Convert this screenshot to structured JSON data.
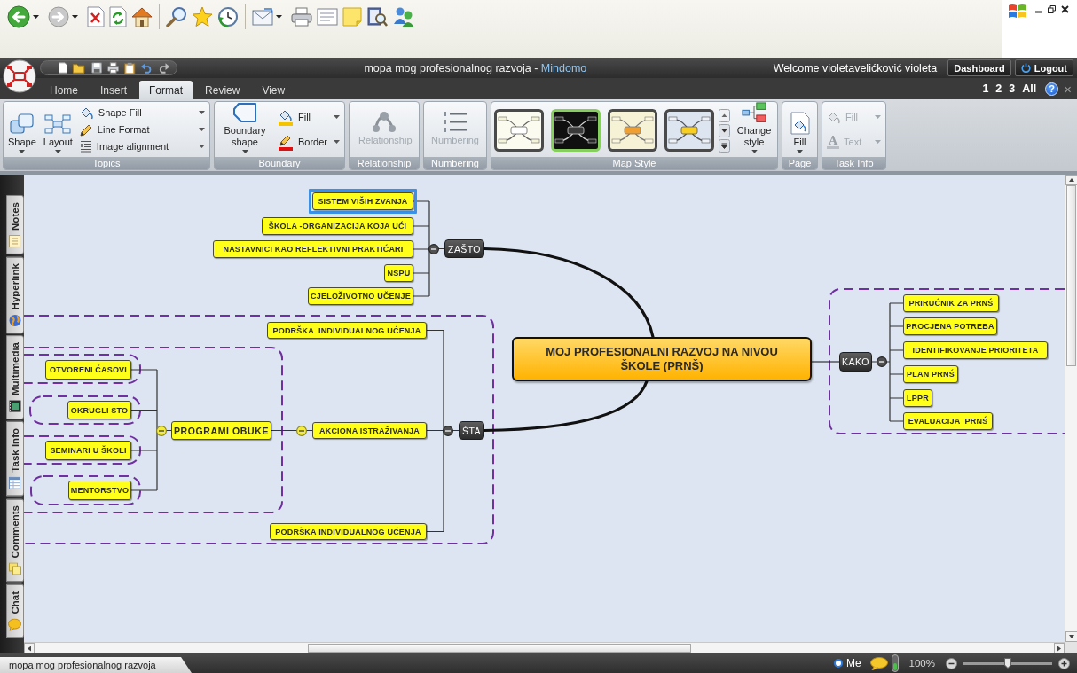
{
  "title_bar": {
    "document": "mopa mog profesionalnog razvoja",
    "separator": "-",
    "app_name": "Mindomo",
    "welcome": "Welcome violetavelićković violeta",
    "buttons": [
      "Dashboard",
      "Logout"
    ]
  },
  "tabs": [
    {
      "label": "Home",
      "selected": false
    },
    {
      "label": "Insert",
      "selected": false
    },
    {
      "label": "Format",
      "selected": true
    },
    {
      "label": "Review",
      "selected": false
    },
    {
      "label": "View",
      "selected": false
    }
  ],
  "view_levels": [
    "1",
    "2",
    "3",
    "All"
  ],
  "help": "?",
  "close": "×",
  "ribbon": [
    {
      "label": "Topics",
      "controls": [
        {
          "kind": "large",
          "label": "Shape",
          "dropdown": true,
          "disabled": false
        },
        {
          "kind": "large",
          "label": "Layout",
          "dropdown": true,
          "disabled": false
        },
        {
          "kind": "small",
          "label": "Shape Fill",
          "dropdown": true,
          "disabled": false
        },
        {
          "kind": "small",
          "label": "Line Format",
          "dropdown": true,
          "disabled": false
        },
        {
          "kind": "small",
          "label": "Image alignment",
          "dropdown": true,
          "disabled": false
        }
      ]
    },
    {
      "label": "Boundary",
      "controls": [
        {
          "kind": "large",
          "label": "Boundary shape",
          "dropdown": true,
          "disabled": false
        },
        {
          "kind": "small",
          "label": "Fill",
          "dropdown": true,
          "disabled": false
        },
        {
          "kind": "small",
          "label": "Border",
          "dropdown": true,
          "disabled": false
        }
      ]
    },
    {
      "label": "Relationship",
      "controls": [
        {
          "kind": "large",
          "label": "Relationship",
          "dropdown": false,
          "disabled": true
        }
      ]
    },
    {
      "label": "Numbering",
      "controls": [
        {
          "kind": "large",
          "label": "Numbering",
          "dropdown": false,
          "disabled": true
        }
      ]
    },
    {
      "label": "Map Style",
      "styles": [
        {
          "selected": false
        },
        {
          "selected": true
        },
        {
          "selected": false
        },
        {
          "selected": false
        }
      ],
      "controls": [
        {
          "kind": "large",
          "label": "Change style",
          "dropdown": true,
          "disabled": false
        }
      ]
    },
    {
      "label": "Page",
      "controls": [
        {
          "kind": "large",
          "label": "Fill",
          "dropdown": true,
          "disabled": false
        }
      ]
    },
    {
      "label": "Task Info",
      "controls": [
        {
          "kind": "small",
          "label": "Fill",
          "dropdown": true,
          "disabled": true
        },
        {
          "kind": "small",
          "label": "Text",
          "glyph": "A",
          "dropdown": true,
          "disabled": true
        }
      ]
    }
  ],
  "side_tabs": [
    "Notes",
    "Hyperlink",
    "Multimedia",
    "Task Info",
    "Comments",
    "Chat"
  ],
  "mind_map": {
    "central": {
      "label": "MOJ PROFESIONALNI RAZVOJ NA NIVOU ŠKOLE (PRNŠ)",
      "selected": false
    },
    "branches": [
      {
        "label": "ZAŠTO",
        "selected": false,
        "expanded": true,
        "boundary": false,
        "children": [
          {
            "label": "SISTEM VIŠIH ZVANJA",
            "selected": true,
            "boundary": false
          },
          {
            "label": "ŠKOLA -ORGANIZACIJA KOJA UĆI",
            "selected": false,
            "boundary": false
          },
          {
            "label": "NASTAVNICI KAO REFLEKTIVNI PRAKTIĆARI",
            "selected": false,
            "boundary": false
          },
          {
            "label": "NSPU",
            "selected": false,
            "boundary": false
          },
          {
            "label": "CJELOŽIVOTNO UČENJE",
            "selected": false,
            "boundary": false
          }
        ]
      },
      {
        "label": "ŠTA",
        "selected": false,
        "expanded": true,
        "boundary": true,
        "children": [
          {
            "label": "PODRŠKA  INDIVIDUALNOG UĆENJA",
            "selected": false,
            "boundary": false
          },
          {
            "label": "AKCIONA ISTRAŽIVANJA",
            "selected": false,
            "expanded": true,
            "boundary": false,
            "children": [
              {
                "label": "PROGRAMI OBUKE",
                "selected": false,
                "expanded": true,
                "boundary": true,
                "children": [
                  {
                    "label": "OTVORENI ĆASOVI",
                    "selected": false,
                    "boundary": true
                  },
                  {
                    "label": "OKRUGLI STO",
                    "selected": false,
                    "boundary": true
                  },
                  {
                    "label": "SEMINARI U ŠKOLI",
                    "selected": false,
                    "boundary": true
                  },
                  {
                    "label": "MENTORSTVO",
                    "selected": false,
                    "boundary": true
                  }
                ]
              }
            ]
          },
          {
            "label": "PODRŠKA INDIVIDUALNOG UĆENJA",
            "selected": false,
            "boundary": false
          }
        ]
      },
      {
        "label": "KAKO",
        "selected": false,
        "expanded": true,
        "boundary": true,
        "children": [
          {
            "label": "PRIRUĆNIK ZA PRNŚ",
            "selected": false,
            "boundary": false
          },
          {
            "label": "PROCJENA POTREBA",
            "selected": false,
            "boundary": false
          },
          {
            "label": "IDENTIFIKOVANJE PRIORITETA",
            "selected": false,
            "boundary": false
          },
          {
            "label": "PLAN PRNŚ",
            "selected": false,
            "boundary": false
          },
          {
            "label": "LPPR",
            "selected": false,
            "boundary": false
          },
          {
            "label": "EVALUACIJA  PRNŚ",
            "selected": false,
            "boundary": false
          }
        ]
      }
    ]
  },
  "status_bar": {
    "document_tab": "mopa mog profesionalnog razvoja",
    "user": "Me",
    "zoom": {
      "label": "100%",
      "level": 0.5
    }
  }
}
